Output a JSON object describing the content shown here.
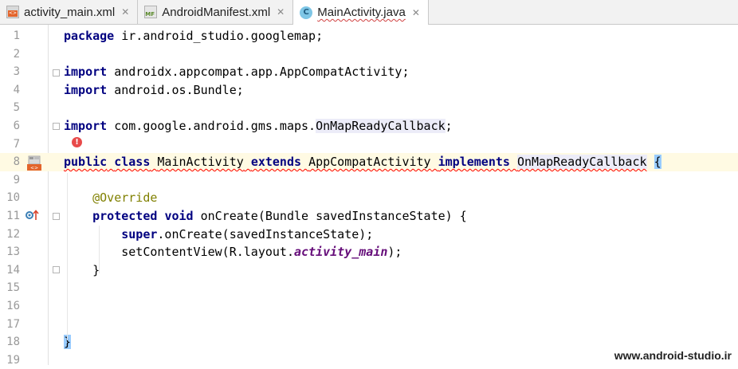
{
  "tabs": [
    {
      "label": "activity_main.xml",
      "icon": "xml-file-icon",
      "active": false,
      "closable": true
    },
    {
      "label": "AndroidManifest.xml",
      "icon": "manifest-file-icon",
      "active": false,
      "closable": true
    },
    {
      "label": "MainActivity.java",
      "icon": "java-class-icon",
      "active": true,
      "closable": true
    }
  ],
  "xml_icon_text": "<>",
  "manifest_icon_text": "MF",
  "class_icon_text": "C",
  "close_glyph": "✕",
  "lines": {
    "1": {
      "num": "1"
    },
    "2": {
      "num": "2"
    },
    "3": {
      "num": "3"
    },
    "4": {
      "num": "4"
    },
    "5": {
      "num": "5"
    },
    "6": {
      "num": "6"
    },
    "7": {
      "num": "7"
    },
    "8": {
      "num": "8"
    },
    "9": {
      "num": "9"
    },
    "10": {
      "num": "10"
    },
    "11": {
      "num": "11"
    },
    "12": {
      "num": "12"
    },
    "13": {
      "num": "13"
    },
    "14": {
      "num": "14"
    },
    "15": {
      "num": "15"
    },
    "16": {
      "num": "16"
    },
    "17": {
      "num": "17"
    },
    "18": {
      "num": "18"
    },
    "19": {
      "num": "19"
    }
  },
  "code": {
    "l1": {
      "kw": "package",
      "rest": " ir.android_studio.googlemap;"
    },
    "l3": {
      "kw": "import",
      "rest": " androidx.appcompat.app.AppCompatActivity;"
    },
    "l4": {
      "kw": "import",
      "rest": " android.os.Bundle;"
    },
    "l6": {
      "kw": "import",
      "rest": " com.google.android.gms.maps.",
      "hl": "OnMapReadyCallback",
      "end": ";"
    },
    "l8": {
      "kw1": "public",
      "kw2": "class",
      "name": "MainActivity",
      "kw3": "extends",
      "parent": "AppCompatActivity",
      "kw4": "implements",
      "iface": "OnMapReadyCallback",
      "brace": "{"
    },
    "l10": {
      "annotation": "@Override"
    },
    "l11": {
      "kw1": "protected",
      "kw2": "void",
      "rest": " onCreate(Bundle savedInstanceState) {"
    },
    "l12": {
      "kw": "super",
      "rest": ".onCreate(savedInstanceState);"
    },
    "l13": {
      "pre": "setContentView(R.layout.",
      "field": "activity_main",
      "post": ");"
    },
    "l14": {
      "text": "}"
    },
    "l18": {
      "brace": "}"
    }
  },
  "error_bulb_glyph": "!",
  "watermark": "www.android-studio.ir",
  "colors": {
    "keyword": "#000080",
    "annotation": "#808000",
    "field": "#660e7a",
    "error_underline": "#ff0000"
  }
}
